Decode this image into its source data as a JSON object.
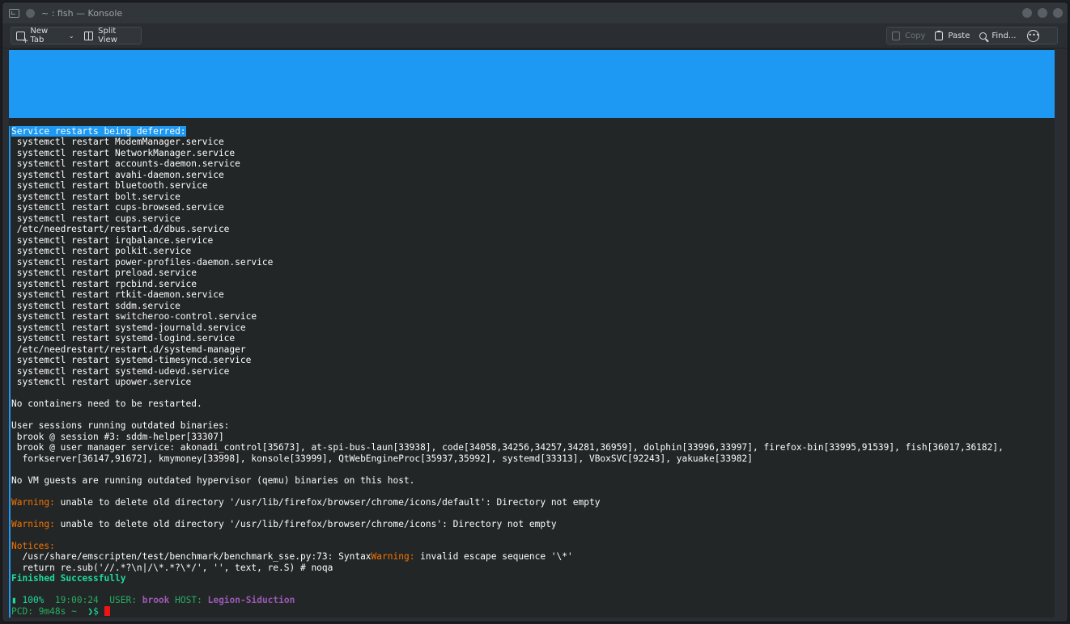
{
  "window": {
    "title": "~ : fish — Konsole"
  },
  "toolbar": {
    "new_tab_label": "New Tab",
    "split_view_label": "Split View",
    "copy_label": "Copy",
    "paste_label": "Paste",
    "find_label": "Find...",
    "icons": [
      "new-tab-icon",
      "split-view-icon",
      "copy-icon",
      "paste-icon",
      "find-icon",
      "more-icon"
    ]
  },
  "terminal": {
    "selected_header": "Service restarts being deferred:",
    "service_lines": [
      " systemctl restart ModemManager.service",
      " systemctl restart NetworkManager.service",
      " systemctl restart accounts-daemon.service",
      " systemctl restart avahi-daemon.service",
      " systemctl restart bluetooth.service",
      " systemctl restart bolt.service",
      " systemctl restart cups-browsed.service",
      " systemctl restart cups.service",
      " /etc/needrestart/restart.d/dbus.service",
      " systemctl restart irqbalance.service",
      " systemctl restart polkit.service",
      " systemctl restart power-profiles-daemon.service",
      " systemctl restart preload.service",
      " systemctl restart rpcbind.service",
      " systemctl restart rtkit-daemon.service",
      " systemctl restart sddm.service",
      " systemctl restart switcheroo-control.service",
      " systemctl restart systemd-journald.service",
      " systemctl restart systemd-logind.service",
      " /etc/needrestart/restart.d/systemd-manager",
      " systemctl restart systemd-timesyncd.service",
      " systemctl restart systemd-udevd.service",
      " systemctl restart upower.service"
    ],
    "no_containers": "No containers need to be restarted.",
    "user_sessions_header": "User sessions running outdated binaries:",
    "session_line_1": " brook @ session #3: sddm-helper[33307]",
    "session_line_2": " brook @ user manager service: akonadi_control[35673], at-spi-bus-laun[33938], code[34058,34256,34257,34281,36959], dolphin[33996,33997], firefox-bin[33995,91539], fish[36017,36182],",
    "session_line_3": "  forkserver[36147,91672], kmymoney[33998], konsole[33999], QtWebEngineProc[35937,35992], systemd[33313], VBoxSVC[92243], yakuake[33982]",
    "no_vm": "No VM guests are running outdated hypervisor (qemu) binaries on this host.",
    "warning_label": "Warning:",
    "warning_1": " unable to delete old directory '/usr/lib/firefox/browser/chrome/icons/default': Directory not empty",
    "warning_2": " unable to delete old directory '/usr/lib/firefox/browser/chrome/icons': Directory not empty",
    "notices_label": "Notices:",
    "notice_path": "  /usr/share/emscripten/test/benchmark/benchmark_sse.py:73: Syntax",
    "notice_warning": "Warning:",
    "notice_rest": " invalid escape sequence '\\*'",
    "notice_code": "  return re.sub('//.*?\\n|/\\*.*?\\*/', '', text, re.S) # noqa",
    "finished": "Finished Successfully",
    "prompt_battery": "▮ 100%",
    "prompt_time": "19:00:24",
    "prompt_user_label": "USER:",
    "prompt_user": "brook",
    "prompt_host_label": "HOST:",
    "prompt_host": "Legion-Siduction",
    "prompt_pcd_label": "PCD:",
    "prompt_pcd": "9m48s",
    "prompt_dir": "~",
    "prompt_arrow": "❯$"
  }
}
